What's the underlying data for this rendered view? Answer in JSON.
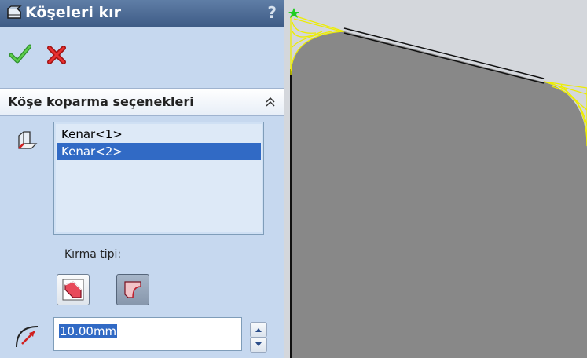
{
  "panel": {
    "title": "Köşeleri kır",
    "help": "?",
    "section": {
      "title": "Köşe koparma seçenekleri"
    },
    "edges": [
      {
        "label": "Kenar<1>",
        "selected": false
      },
      {
        "label": "Kenar<2>",
        "selected": true
      }
    ],
    "break_type_label": "Kırma tipi:",
    "break_type_selected": "fillet",
    "distance_value": "10.00mm"
  },
  "icons": {
    "title": "sheet-metal-icon",
    "ok": "check-icon",
    "cancel": "x-icon",
    "collapse": "double-chevron-up-icon",
    "edges": "edge-select-icon",
    "chamfer": "chamfer-icon",
    "fillet": "fillet-icon",
    "radius": "radius-icon"
  },
  "colors": {
    "title_bar": "#4a6a94",
    "panel_bg": "#c6d8ef",
    "selection": "#316ac5",
    "ok_green": "#3aa83a",
    "cancel_red": "#d02020",
    "part_face": "#888888",
    "preview_yellow": "#f0f000"
  }
}
